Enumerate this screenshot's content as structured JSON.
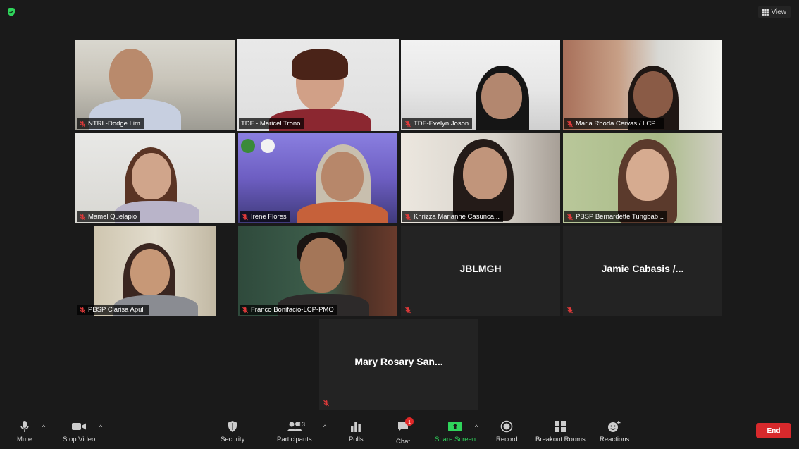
{
  "colors": {
    "background": "#1a1a1a",
    "active_speaker": "#b9e26a",
    "share_screen": "#2fd45b",
    "end": "#d8292c",
    "badge": "#e02828"
  },
  "topbar": {
    "view_label": "View",
    "security_icon": "shield-check-icon",
    "view_icon": "grid-icon"
  },
  "participants": [
    {
      "name": "NTRL-Dodge Lim",
      "muted": true,
      "video": true
    },
    {
      "name": "TDF - Maricel Trono",
      "muted": false,
      "video": true,
      "active_speaker": true
    },
    {
      "name": "TDF-Evelyn Joson",
      "muted": true,
      "video": true
    },
    {
      "name": "Maria Rhoda Cervas / LCP...",
      "muted": true,
      "video": true
    },
    {
      "name": "Mamel Quelapio",
      "muted": true,
      "video": true
    },
    {
      "name": "Irene Flores",
      "muted": true,
      "video": true
    },
    {
      "name": "Khrizza Marianne Casunca...",
      "muted": true,
      "video": true
    },
    {
      "name": "PBSP Bernardette Tungbab...",
      "muted": true,
      "video": true
    },
    {
      "name": "PBSP Clarisa Apuli",
      "muted": true,
      "video": true
    },
    {
      "name": "Franco Bonifacio-LCP-PMO",
      "muted": true,
      "video": true
    },
    {
      "name": "JBLMGH",
      "muted": true,
      "video": false
    },
    {
      "name": "Jamie Cabasis /...",
      "muted": true,
      "video": false
    },
    {
      "name": "Mary Rosary San...",
      "muted": true,
      "video": false
    }
  ],
  "toolbar": {
    "mute": "Mute",
    "stop_video": "Stop Video",
    "security": "Security",
    "participants": "Participants",
    "participants_count": "13",
    "polls": "Polls",
    "chat": "Chat",
    "chat_badge": "1",
    "share_screen": "Share Screen",
    "record": "Record",
    "breakout_rooms": "Breakout Rooms",
    "reactions": "Reactions",
    "end": "End"
  }
}
